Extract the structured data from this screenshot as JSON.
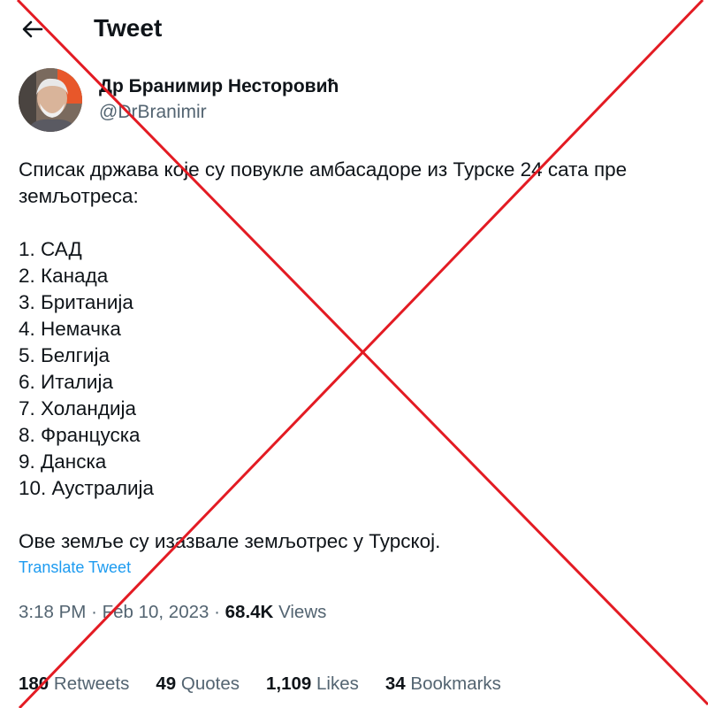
{
  "header": {
    "title": "Tweet",
    "back_icon": "arrow-left-icon"
  },
  "author": {
    "name": "Др Бранимир Несторовић",
    "handle": "@DrBranimir"
  },
  "tweet": {
    "text": "Списак држава које су повукле амбасадоре из Турске 24 сата пре\nземљотреса:\n\n1. САД\n2. Канада\n3. Британија\n4. Немачка\n5. Белгија\n6. Италија\n7. Холандија\n8. Француска\n9. Данска\n10. Аустралија\n\nОве земље су изазвале земљотрес у Турској.",
    "translate_label": "Translate Tweet",
    "time": "3:18 PM",
    "separator": "·",
    "date": "Feb 10, 2023",
    "views_count": "68.4K",
    "views_label": "Views"
  },
  "stats": {
    "retweets_count": "180",
    "retweets_label": "Retweets",
    "quotes_count": "49",
    "quotes_label": "Quotes",
    "likes_count": "1,109",
    "likes_label": "Likes",
    "bookmarks_count": "34",
    "bookmarks_label": "Bookmarks"
  },
  "overlay": {
    "cross_color": "#e31b23"
  }
}
